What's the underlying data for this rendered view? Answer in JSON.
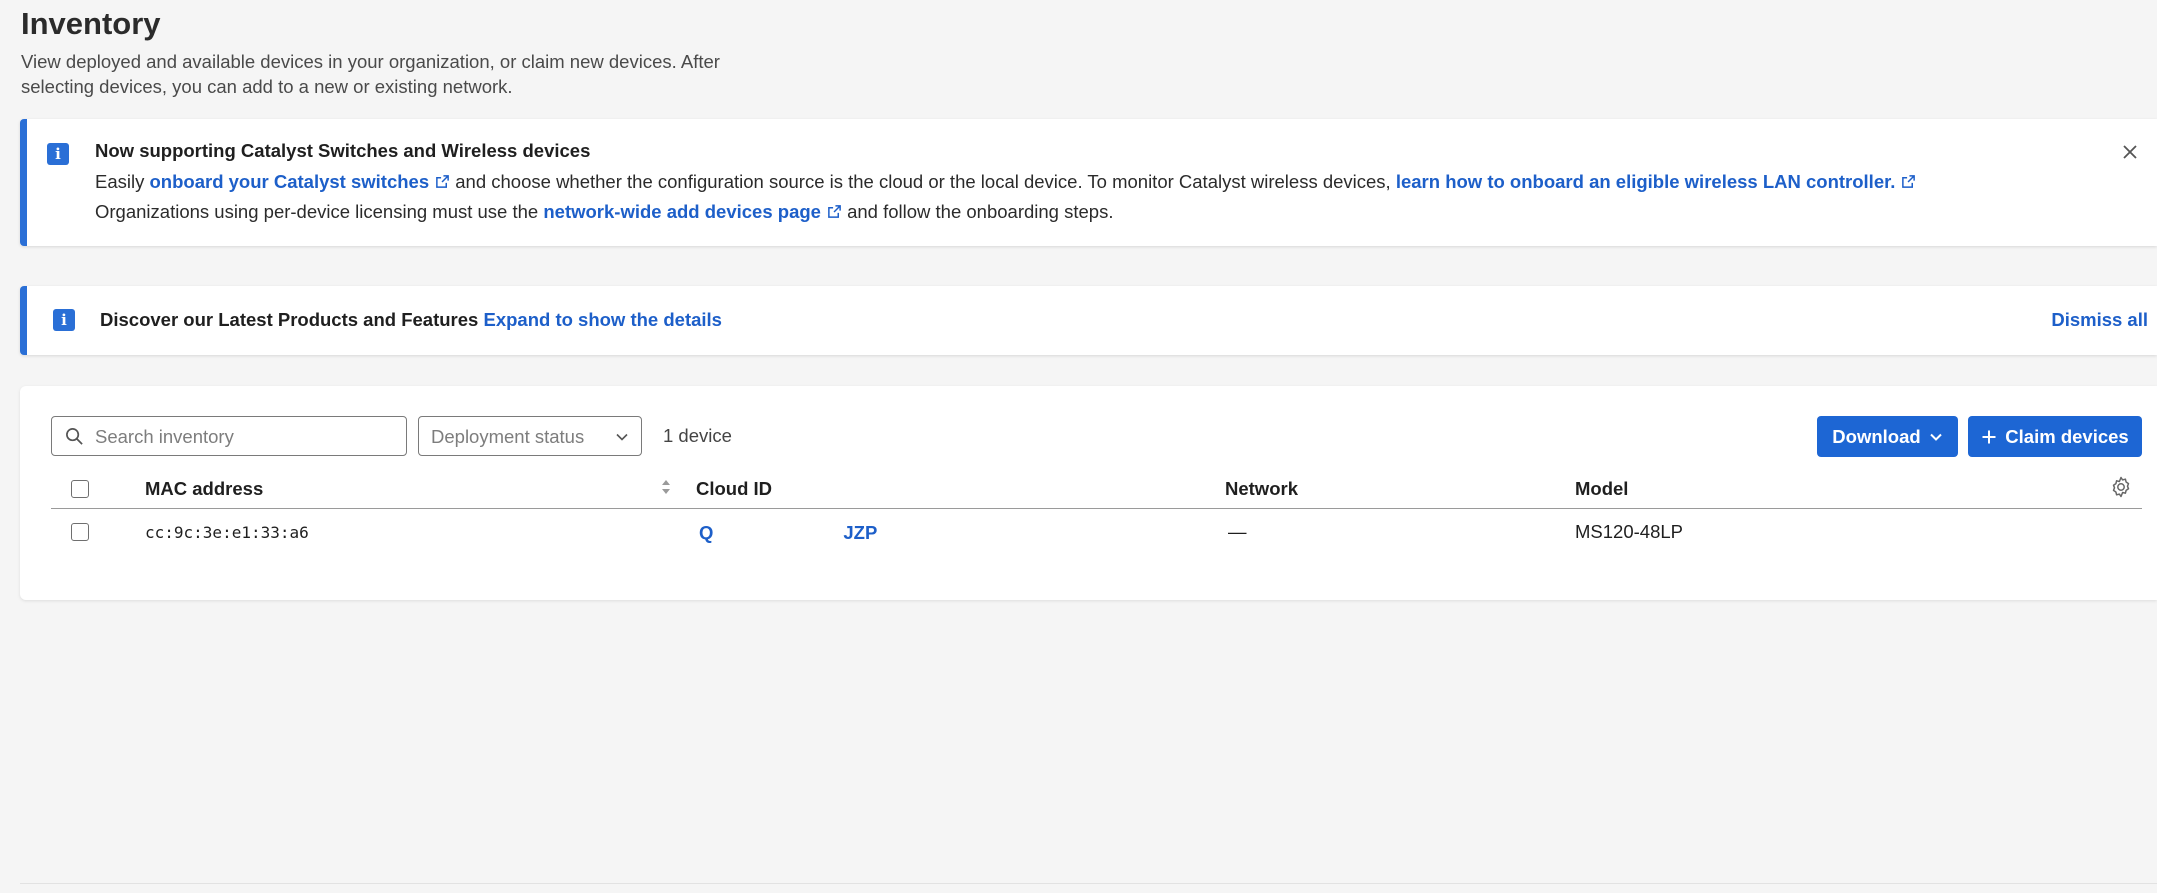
{
  "page": {
    "title": "Inventory",
    "description": "View deployed and available devices in your organization, or claim new devices. After selecting devices, you can add to a new or existing network."
  },
  "banner_catalyst": {
    "heading": "Now supporting Catalyst Switches and Wireless devices",
    "line1_prefix": "Easily ",
    "line1_link1": "onboard your Catalyst switches",
    "line1_middle": " and choose whether the configuration source is the cloud or the local device. To monitor Catalyst wireless devices, ",
    "line1_link2": "learn how to onboard an eligible wireless LAN controller.",
    "line2_prefix": "Organizations using per-device licensing must use the ",
    "line2_link": "network-wide add devices page",
    "line2_suffix": " and follow the onboarding steps."
  },
  "banner_discover": {
    "text": "Discover our Latest Products and Features",
    "expand_link": "Expand to show the details",
    "dismiss_label": "Dismiss all"
  },
  "toolbar": {
    "search_placeholder": "Search inventory",
    "deployment_status_label": "Deployment status",
    "device_count": "1 device",
    "download_label": "Download",
    "claim_label": "Claim devices"
  },
  "table": {
    "columns": [
      "MAC address",
      "Cloud ID",
      "Network",
      "Model"
    ],
    "rows": [
      {
        "mac": "cc:9c:3e:e1:33:a6",
        "cloud_id_start": "Q",
        "cloud_id_end": "JZP",
        "network": "—",
        "model": "MS120-48LP"
      }
    ]
  },
  "colors": {
    "accent": "#1d66d4",
    "link": "#1d5fc9",
    "banner_border": "#2a6fd6",
    "background": "#f5f5f5"
  },
  "icons": [
    "info-icon",
    "external-link-icon",
    "close-icon",
    "search-icon",
    "chevron-down-icon",
    "plus-icon",
    "sort-icon",
    "gear-icon"
  ]
}
